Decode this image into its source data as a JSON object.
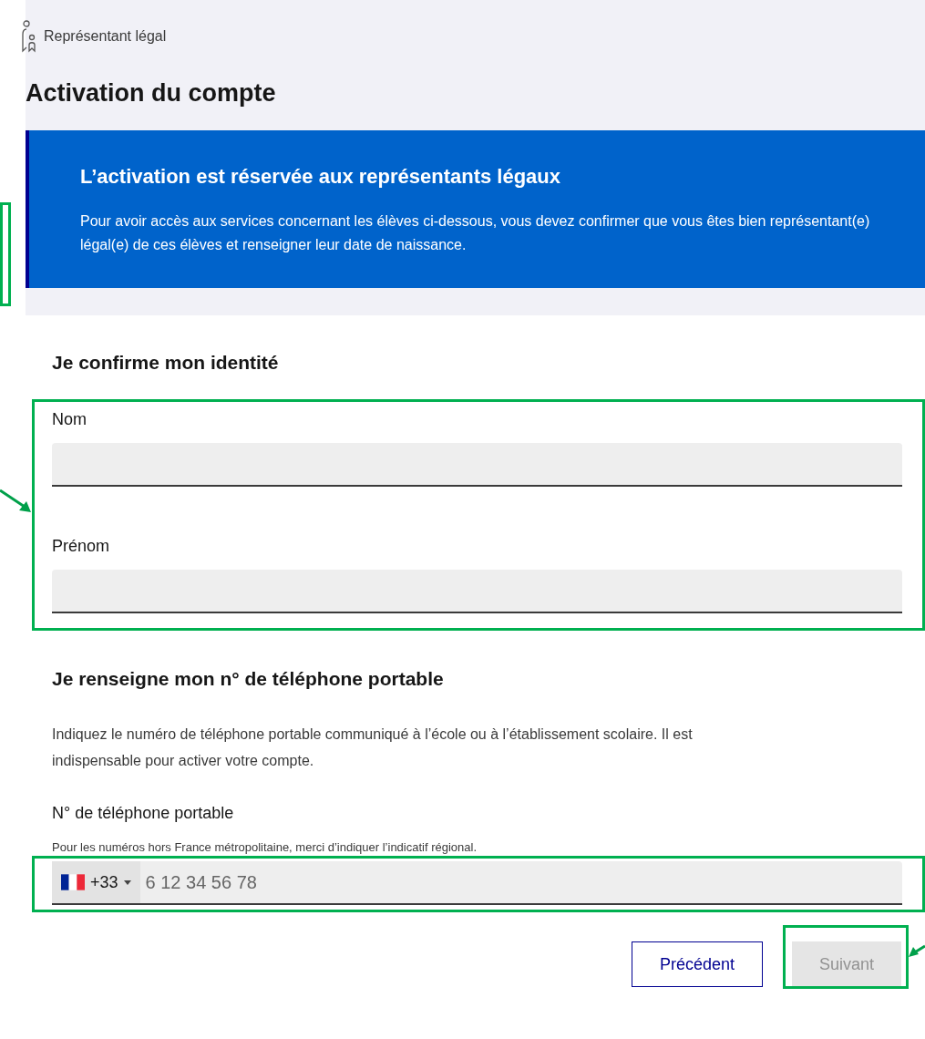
{
  "breadcrumb": "Représentant légal",
  "title": "Activation du compte",
  "notice": {
    "title": "L’activation est réservée aux représentants légaux",
    "text": "Pour avoir accès aux services concernant les élèves ci-dessous, vous devez confirmer que vous êtes bien représentant(e) légal(e) de ces élèves et renseigner leur date de naissance."
  },
  "identity": {
    "heading": "Je confirme mon identité",
    "fields": [
      {
        "label": "Nom"
      },
      {
        "label": "Prénom"
      }
    ]
  },
  "phone": {
    "heading": "Je renseigne mon n° de téléphone portable",
    "intro": "Indiquez le numéro de téléphone portable communiqué à l’école ou à l’établissement scolaire. Il est indispensable pour activer votre compte.",
    "label": "N° de téléphone portable",
    "hint": "Pour les numéros hors France métropolitaine, merci d’indiquer l’indicatif régional.",
    "country_code": "+33",
    "placeholder": "6 12 34 56 78"
  },
  "buttons": [
    {
      "label": "Précédent",
      "kind": "secondary",
      "disabled": false
    },
    {
      "label": "Suivant",
      "kind": "primary",
      "disabled": true
    }
  ]
}
